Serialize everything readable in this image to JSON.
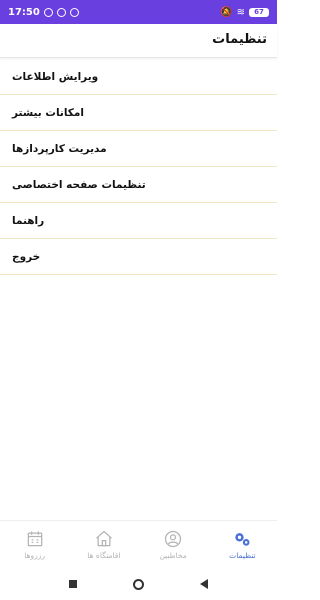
{
  "status_bar": {
    "time": "17:50",
    "battery": "67",
    "background": "#6a3fe0"
  },
  "header": {
    "title": "تنظیمات"
  },
  "menu": {
    "items": [
      {
        "label": "ویرایش اطلاعات"
      },
      {
        "label": "امکانات بیشتر"
      },
      {
        "label": "مدیریت کارپردازها"
      },
      {
        "label": "تنظیمات صفحه اختصاصی"
      },
      {
        "label": "راهنما"
      },
      {
        "label": "خروج"
      }
    ]
  },
  "bottom_nav": {
    "active_color": "#4a6fd6",
    "items": [
      {
        "label": "تنظیمات",
        "icon": "gears-icon",
        "active": true
      },
      {
        "label": "مخاطبین",
        "icon": "user-icon",
        "active": false
      },
      {
        "label": "اقامتگاه ها",
        "icon": "home-icon",
        "active": false
      },
      {
        "label": "رزروها",
        "icon": "calendar-icon",
        "active": false
      }
    ]
  }
}
